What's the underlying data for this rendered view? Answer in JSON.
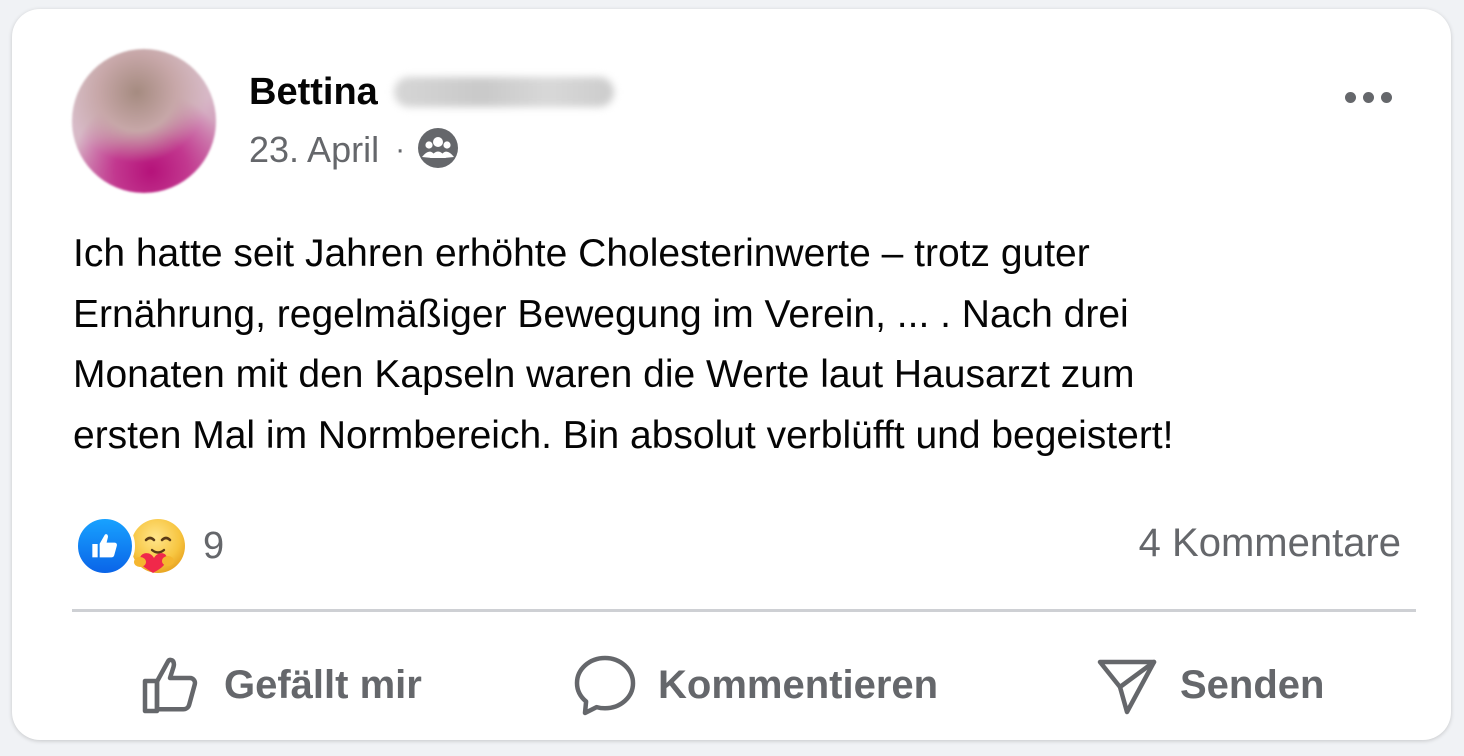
{
  "post": {
    "author_first_name": "Bettina",
    "date": "23. April",
    "separator": "·",
    "audience_icon": "group-icon",
    "more_icon": "more-horizontal-icon",
    "text_lines": [
      "Ich hatte seit Jahren erhöhte Cholesterinwerte – trotz guter",
      "Ernährung, regelmäßiger Bewegung im Verein, ... . Nach drei",
      "Monaten mit den Kapseln waren die Werte laut Hausarzt zum",
      "ersten Mal im Normbereich. Bin absolut verblüfft und begeistert!"
    ]
  },
  "stats": {
    "reaction_icons": [
      "like-reaction-icon",
      "care-reaction-icon"
    ],
    "reaction_count": "9",
    "comments_label": "4 Kommentare"
  },
  "actions": {
    "like_label": "Gefällt mir",
    "comment_label": "Kommentieren",
    "send_label": "Senden"
  },
  "colors": {
    "text_primary": "#050505",
    "text_secondary": "#65676b",
    "like_blue": "#0a64e8",
    "divider": "#ced0d4"
  }
}
